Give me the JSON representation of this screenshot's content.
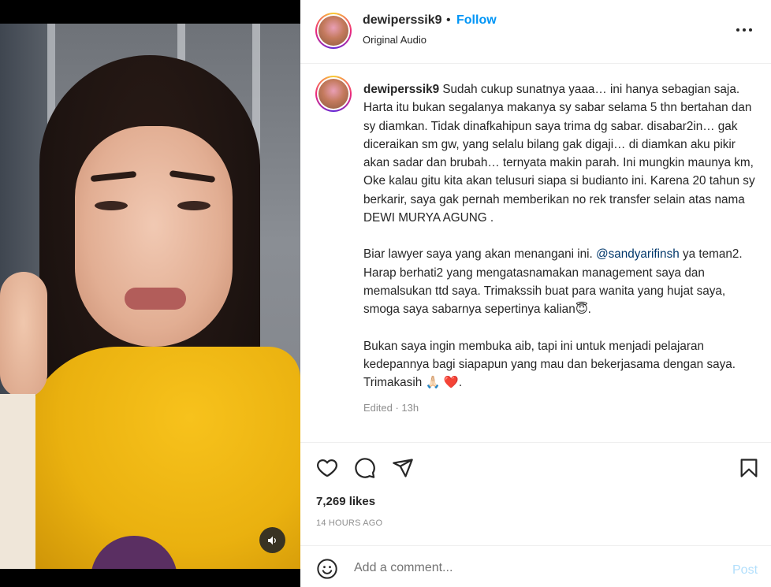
{
  "post": {
    "username": "dewiperssik9",
    "dot": "•",
    "follow_label": "Follow",
    "audio_label": "Original Audio",
    "caption": {
      "username": "dewiperssik9",
      "para1": "Sudah cukup sunatnya yaaa… ini hanya sebagian saja. Harta itu bukan segalanya makanya sy sabar selama 5 thn bertahan dan sy diamkan. Tidak dinafkahipun saya trima dg sabar. disabar2in… gak diceraikan sm gw, yang selalu bilang gak digaji… di diamkan aku pikir akan sadar dan brubah… ternyata makin parah. Ini mungkin maunya km, Oke kalau gitu kita akan telusuri siapa si budianto ini. Karena 20 tahun sy berkarir, saya gak pernah memberikan no rek transfer selain atas nama DEWI MURYA AGUNG .",
      "para2_before": "Biar lawyer saya yang akan menangani ini. ",
      "para2_mention": "@sandyarifinsh",
      "para2_after": " ya teman2. Harap berhati2 yang mengatasnamakan management saya dan memalsukan ttd saya. Trimakssih buat para wanita yang hujat saya, smoga saya sabarnya sepertinya kalian😇.",
      "para3": "Bukan saya ingin membuka aib, tapi ini untuk menjadi pelajaran kedepannya bagi siapapun yang mau dan bekerjasama dengan saya. Trimakasih 🙏🏻 ❤️."
    },
    "edited": "Edited · 13h",
    "likes": "7,269 likes",
    "time_ago": "14 HOURS AGO"
  },
  "comment": {
    "placeholder": "Add a comment...",
    "post_label": "Post"
  },
  "icons": {
    "like": "heart-icon",
    "comment": "comment-icon",
    "share": "share-icon",
    "save": "bookmark-icon",
    "emoji": "emoji-icon",
    "more": "more-options-icon",
    "mute": "speaker-icon"
  },
  "colors": {
    "accent": "#0095f6",
    "mention": "#00376b",
    "post_disabled": "#b2dffc"
  }
}
